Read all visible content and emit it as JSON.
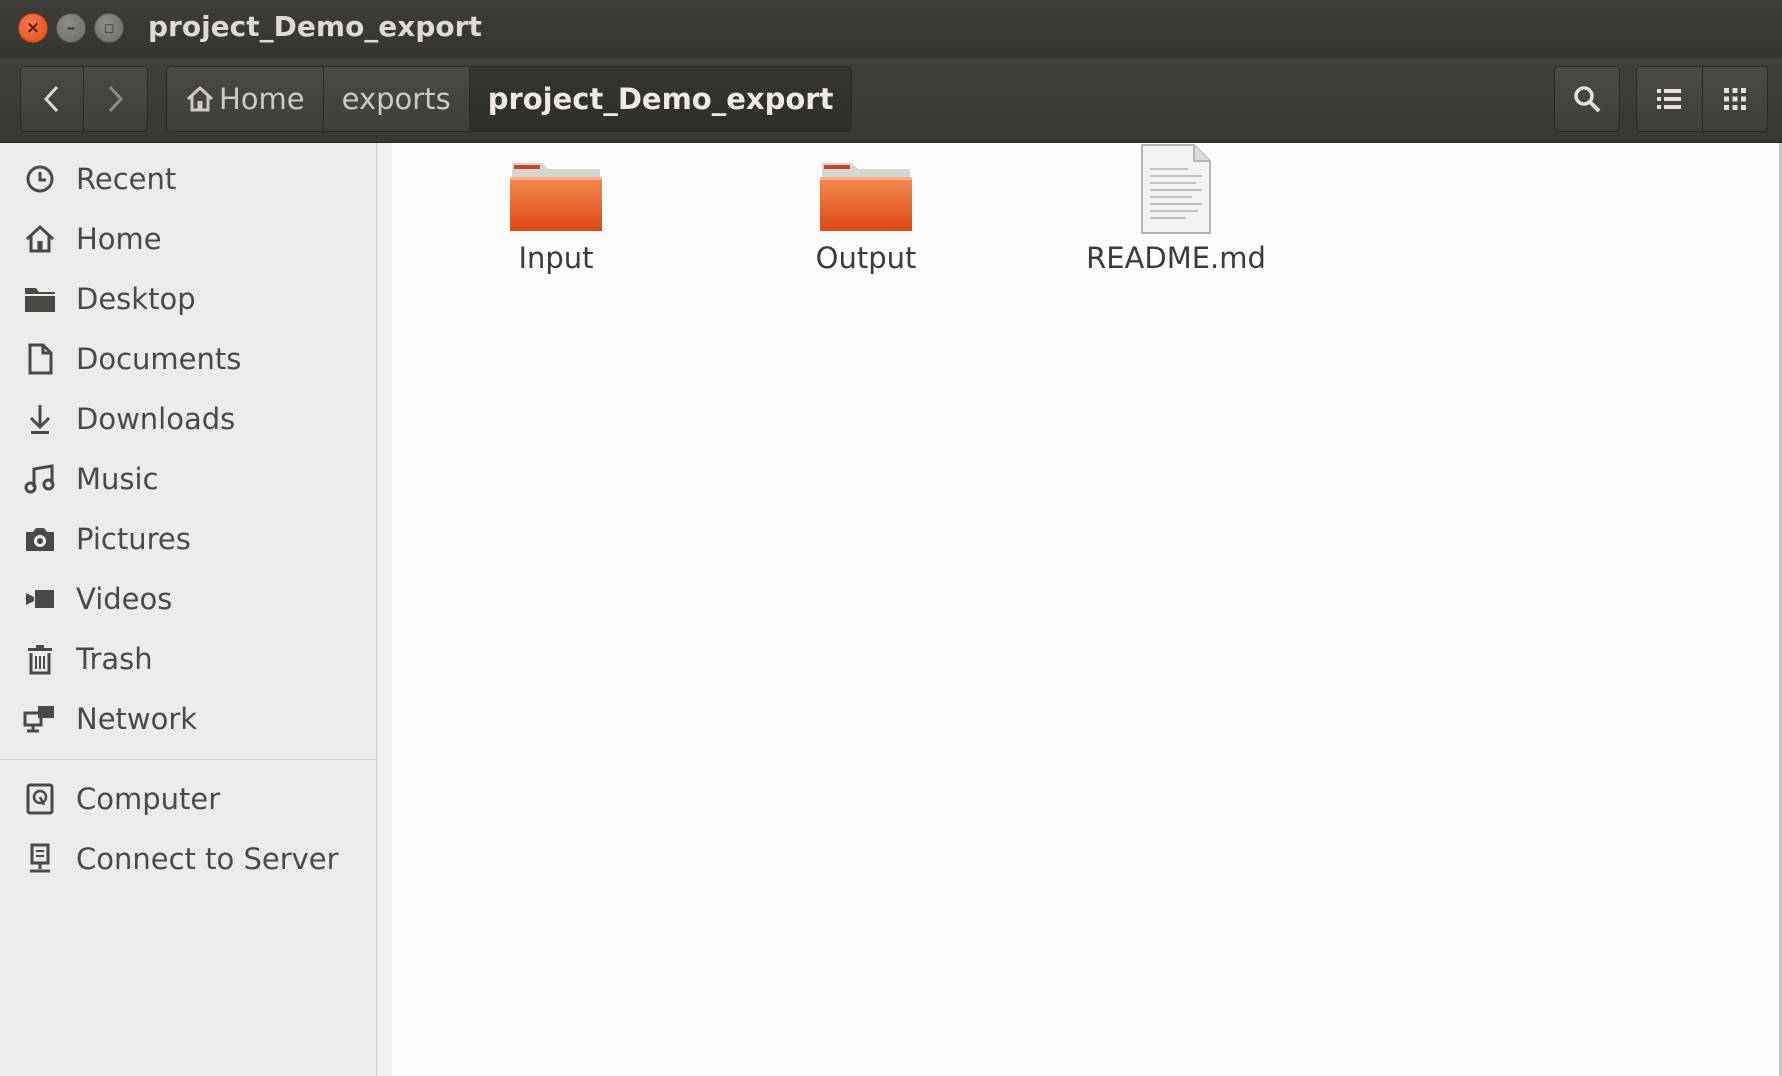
{
  "window": {
    "title": "project_Demo_export",
    "controls": [
      "close",
      "minimize",
      "maximize"
    ]
  },
  "toolbar": {
    "back_icon": "chevron-left-icon",
    "forward_icon": "chevron-right-icon",
    "breadcrumb": [
      {
        "label": "Home",
        "icon": "home-icon"
      },
      {
        "label": "exports"
      },
      {
        "label": "project_Demo_export",
        "current": true
      }
    ],
    "search_icon": "search-icon",
    "list_view_icon": "list-view-icon",
    "grid_view_icon": "grid-view-icon"
  },
  "sidebar": {
    "places": [
      {
        "label": "Recent",
        "icon": "clock-icon"
      },
      {
        "label": "Home",
        "icon": "home-icon"
      },
      {
        "label": "Desktop",
        "icon": "folder-icon"
      },
      {
        "label": "Documents",
        "icon": "document-icon"
      },
      {
        "label": "Downloads",
        "icon": "download-icon"
      },
      {
        "label": "Music",
        "icon": "music-icon"
      },
      {
        "label": "Pictures",
        "icon": "camera-icon"
      },
      {
        "label": "Videos",
        "icon": "video-icon"
      },
      {
        "label": "Trash",
        "icon": "trash-icon"
      },
      {
        "label": "Network",
        "icon": "network-icon"
      }
    ],
    "devices": [
      {
        "label": "Computer",
        "icon": "computer-icon"
      },
      {
        "label": "Connect to Server",
        "icon": "server-icon"
      }
    ]
  },
  "files": [
    {
      "name": "Input",
      "type": "folder"
    },
    {
      "name": "Output",
      "type": "folder"
    },
    {
      "name": "README.md",
      "type": "text-file"
    }
  ],
  "colors": {
    "folder": "#e5531b",
    "titlebar": "#3c3b37",
    "sidebar_bg": "#edecea",
    "main_bg": "#fcfcfc"
  }
}
